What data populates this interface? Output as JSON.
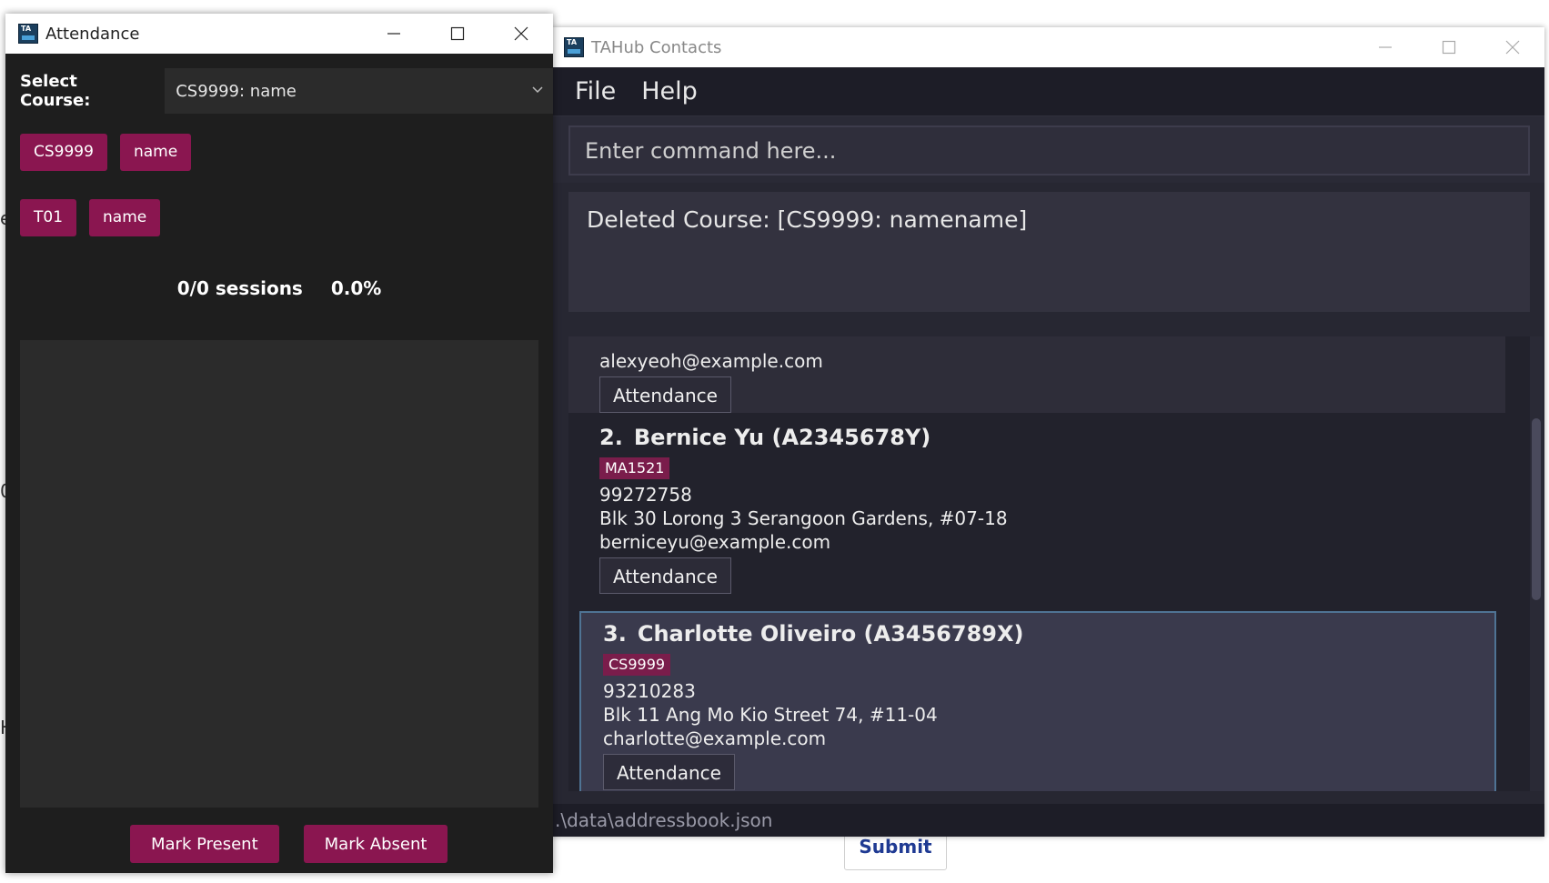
{
  "background": {
    "submit_label": "Submit",
    "fragments": [
      "e",
      "0",
      "H"
    ]
  },
  "main_window": {
    "title": "TAHub Contacts",
    "menu": [
      "File",
      "Help"
    ],
    "command_placeholder": "Enter command here...",
    "result_text": "Deleted Course: [CS9999: namename]",
    "persons": [
      {
        "index": "",
        "name": "",
        "email": "alexyeoh@example.com",
        "attendance_label": "Attendance"
      },
      {
        "index": "2.",
        "name": "Bernice Yu (A2345678Y)",
        "tag": "MA1521",
        "phone": "99272758",
        "address": "Blk 30 Lorong 3 Serangoon Gardens, #07-18",
        "email": "berniceyu@example.com",
        "attendance_label": "Attendance"
      },
      {
        "index": "3.",
        "name": "Charlotte Oliveiro (A3456789X)",
        "tag": "CS9999",
        "phone": "93210283",
        "address": "Blk 11 Ang Mo Kio Street 74, #11-04",
        "email": "charlotte@example.com",
        "attendance_label": "Attendance"
      }
    ],
    "status_path": ".\\data\\addressbook.json"
  },
  "attendance_window": {
    "title": "Attendance",
    "select_label": "Select Course:",
    "select_value": "CS9999: name",
    "course_pills": [
      "CS9999",
      "name"
    ],
    "tutorial_pills": [
      "T01",
      "name"
    ],
    "sessions": "0/0 sessions",
    "percentage": "0.0%",
    "mark_present_label": "Mark Present",
    "mark_absent_label": "Mark Absent"
  },
  "colors": {
    "accent": "#8a1650",
    "dark_bg": "#272732",
    "selected_border": "#4f7394"
  }
}
